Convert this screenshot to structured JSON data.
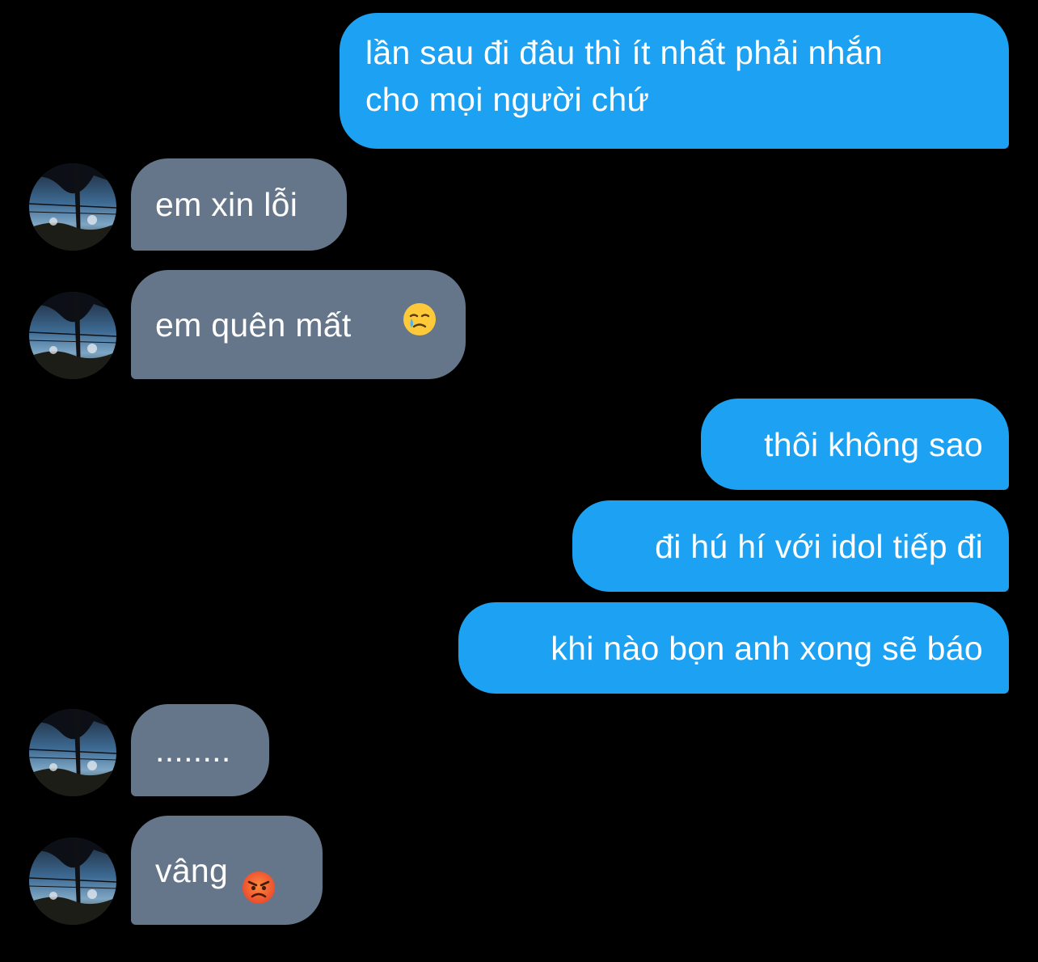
{
  "conversation": {
    "colors": {
      "background": "#000000",
      "sent_bubble": "#1da1f2",
      "received_bubble": "#66768a",
      "text": "#ffffff"
    },
    "messages": [
      {
        "direction": "sent",
        "text": "lần sau đi đâu thì ít nhất phải nhắn\ncho mọi người chứ"
      },
      {
        "direction": "received",
        "text": "em xin lỗi"
      },
      {
        "direction": "received",
        "text": "em quên mất",
        "emoji": "face-holding-back-tears-icon"
      },
      {
        "direction": "sent",
        "text": "thôi không sao"
      },
      {
        "direction": "sent",
        "text": "đi hú hí với idol tiếp đi"
      },
      {
        "direction": "sent",
        "text": "khi nào bọn anh xong sẽ báo"
      },
      {
        "direction": "received",
        "text": "........"
      },
      {
        "direction": "received",
        "text": "vâng",
        "emoji": "angry-face-icon"
      }
    ]
  }
}
